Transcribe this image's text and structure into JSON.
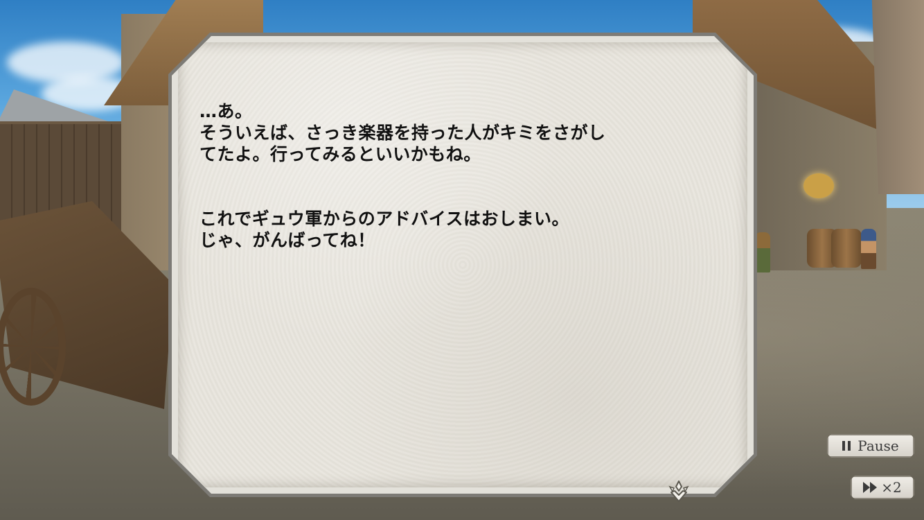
{
  "dialog": {
    "line1": "…あ。\nそういえば、さっき楽器を持った人がキミをさがし\nてたよ。行ってみるといいかもね。",
    "line2": "これでギュウ軍からのアドバイスはおしまい。\nじゃ、がんばってね！"
  },
  "controls": {
    "pause_label": "Pause",
    "speed_label": "×2"
  },
  "icons": {
    "pause": "pause-icon",
    "fast_forward": "fast-forward-icon",
    "advance": "advance-arrow-icon"
  },
  "colors": {
    "panel_paper": "#e8e5de",
    "panel_border": "#7d7b76",
    "text": "#111111"
  }
}
